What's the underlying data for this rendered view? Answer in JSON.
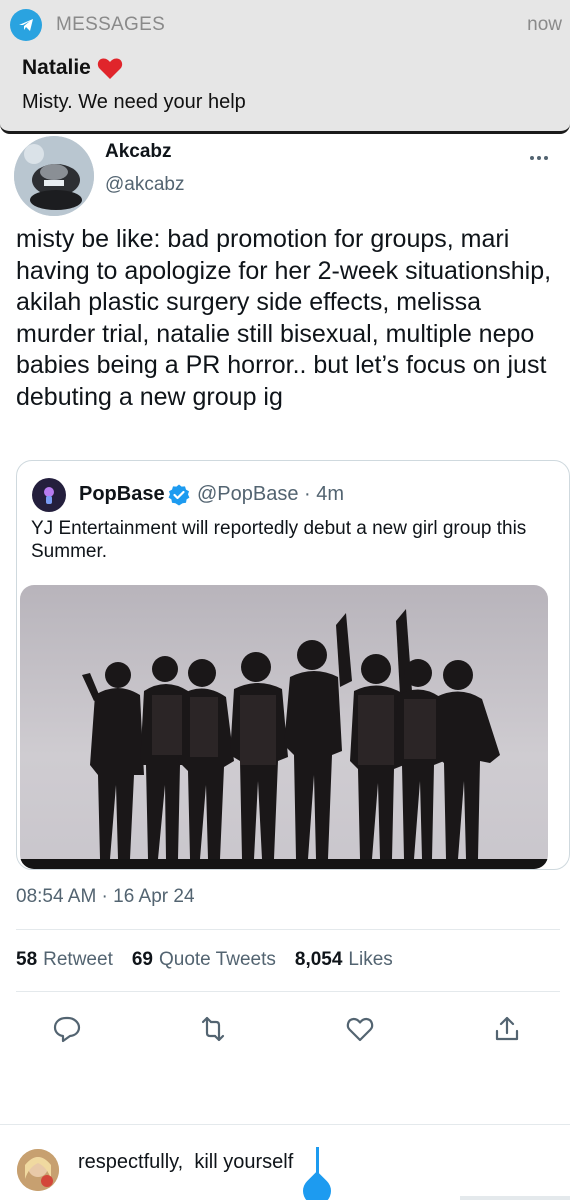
{
  "notification": {
    "app_name": "MESSAGES",
    "time": "now",
    "sender": "Natalie",
    "message": "Misty. We need your help",
    "accent": "#2aa3e0"
  },
  "tweet": {
    "author_name": "Akcabz",
    "author_handle": "@akcabz",
    "text": "misty be like: bad promotion for groups, mari having to apologize for her 2-week situationship, akilah plastic surgery side effects, melissa murder trial, natalie still bisexual, multiple nepo babies being a PR horror.. but let’s focus on just debuting a new group ig",
    "timestamp": "08:54 AM · 16 Apr 24",
    "quote": {
      "name": "PopBase",
      "meta": "@PopBase · 4m",
      "text": "YJ Entertainment will reportedly debut a new girl group this Summer."
    },
    "stats": {
      "retweets_count": "58",
      "retweets_label": "Retweet",
      "quotes_count": "69",
      "quotes_label": "Quote Tweets",
      "likes_count": "8,054",
      "likes_label": "Likes"
    }
  },
  "reply": {
    "text": "respectfully,  kill yourself"
  },
  "colors": {
    "link_blue": "#1d9bf0",
    "secondary_text": "#536471",
    "primary_text": "#0f1419"
  }
}
